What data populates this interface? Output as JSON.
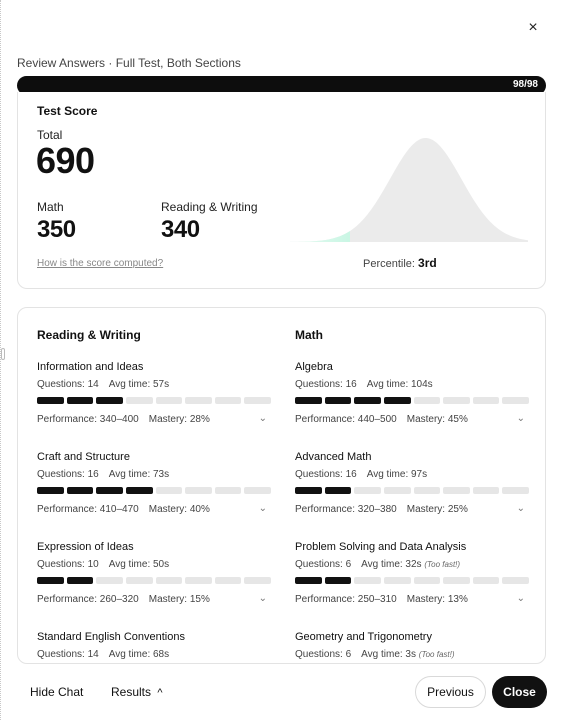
{
  "dialog": {
    "close_glyph": "×",
    "title": "Review Answers · Full Test, Both Sections",
    "progress_label": "98/98",
    "progress_fraction": 1.0
  },
  "score": {
    "heading": "Test Score",
    "total_label": "Total",
    "total_value": "690",
    "math_label": "Math",
    "math_value": "350",
    "rw_label": "Reading & Writing",
    "rw_value": "340",
    "link": "How is the score computed?",
    "percentile_label": "Percentile:",
    "percentile_value": "3rd",
    "percentile_fraction": 0.03,
    "accent_color": "#6ee7b7"
  },
  "reading_writing": {
    "title": "Reading & Writing",
    "domains": [
      {
        "name": "Information and Ideas",
        "questions": "Questions: 14",
        "time": "Avg time: 57s",
        "flag": "",
        "filled": 3,
        "total": 8,
        "performance": "Performance: 340–400",
        "mastery": "Mastery: 28%"
      },
      {
        "name": "Craft and Structure",
        "questions": "Questions: 16",
        "time": "Avg time: 73s",
        "flag": "",
        "filled": 4,
        "total": 8,
        "performance": "Performance: 410–470",
        "mastery": "Mastery: 40%"
      },
      {
        "name": "Expression of Ideas",
        "questions": "Questions: 10",
        "time": "Avg time: 50s",
        "flag": "",
        "filled": 2,
        "total": 8,
        "performance": "Performance: 260–320",
        "mastery": "Mastery: 15%"
      },
      {
        "name": "Standard English Conventions",
        "questions": "Questions: 14",
        "time": "Avg time: 68s",
        "flag": ""
      }
    ]
  },
  "math": {
    "title": "Math",
    "domains": [
      {
        "name": "Algebra",
        "questions": "Questions: 16",
        "time": "Avg time: 104s",
        "flag": "",
        "filled": 4,
        "total": 8,
        "performance": "Performance: 440–500",
        "mastery": "Mastery: 45%"
      },
      {
        "name": "Advanced Math",
        "questions": "Questions: 16",
        "time": "Avg time: 97s",
        "flag": "",
        "filled": 2,
        "total": 8,
        "performance": "Performance: 320–380",
        "mastery": "Mastery: 25%"
      },
      {
        "name": "Problem Solving and Data Analysis",
        "questions": "Questions: 6",
        "time": "Avg time: 32s",
        "flag": "(Too fast!)",
        "filled": 2,
        "total": 8,
        "performance": "Performance: 250–310",
        "mastery": "Mastery: 13%"
      },
      {
        "name": "Geometry and Trigonometry",
        "questions": "Questions: 6",
        "time": "Avg time: 3s",
        "flag": "(Too fast!)"
      }
    ]
  },
  "footer": {
    "hide_chat": "Hide Chat",
    "results": "Results",
    "results_chevron": "^",
    "previous": "Previous",
    "close": "Close"
  },
  "icons": {
    "close": "close-icon",
    "expand": "chevron-down-icon",
    "results_toggle": "chevron-up-icon"
  }
}
